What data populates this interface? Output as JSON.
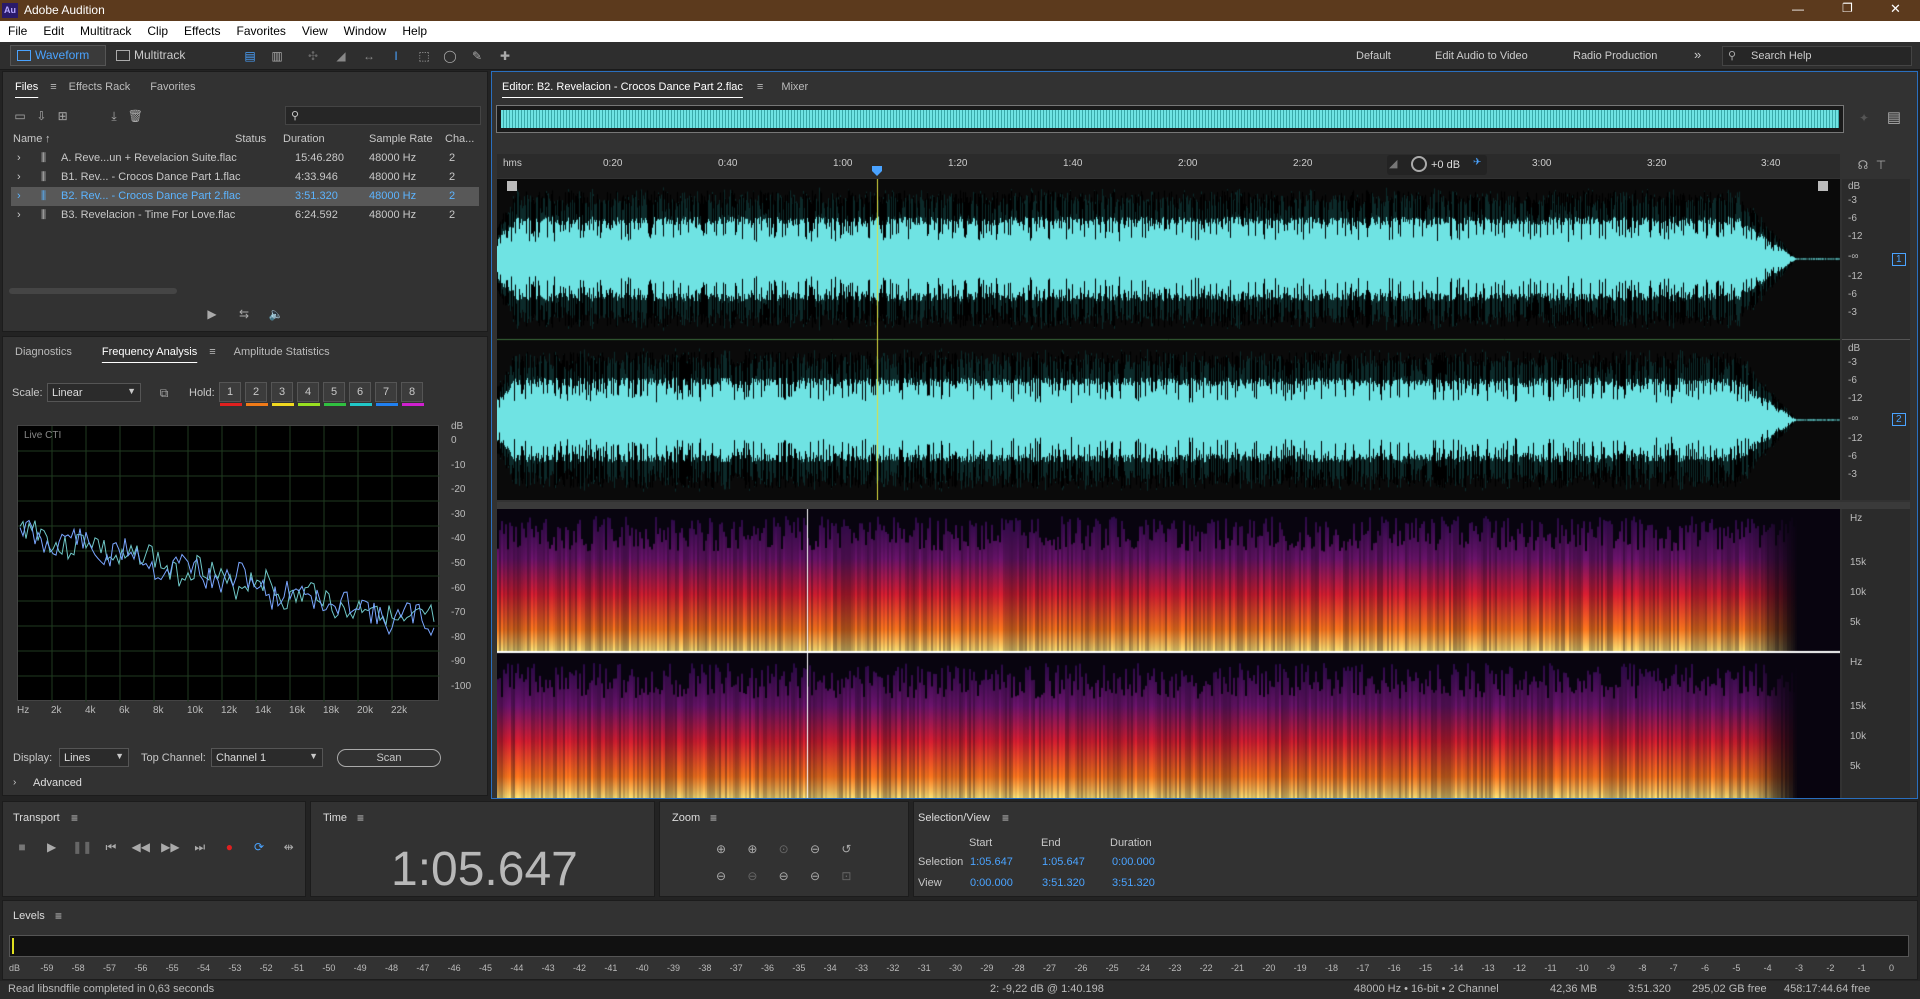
{
  "app": {
    "title": "Adobe Audition",
    "logo": "Au"
  },
  "menu": [
    "File",
    "Edit",
    "Multitrack",
    "Clip",
    "Effects",
    "Favorites",
    "View",
    "Window",
    "Help"
  ],
  "toolbar": {
    "waveform": "Waveform",
    "multitrack": "Multitrack",
    "workspaces": [
      "Default",
      "Edit Audio to Video",
      "Radio Production"
    ],
    "search_placeholder": "Search Help"
  },
  "files_panel": {
    "tabs": [
      "Files",
      "Effects Rack",
      "Favorites"
    ],
    "search_placeholder": "",
    "columns": [
      "Name",
      "Status",
      "Duration",
      "Sample Rate",
      "Cha..."
    ],
    "rows": [
      {
        "name": "A. Reve...un + Revelacion Suite.flac",
        "status": "",
        "duration": "15:46.280",
        "rate": "48000 Hz",
        "ch": "2"
      },
      {
        "name": "B1. Rev... - Crocos Dance Part 1.flac",
        "status": "",
        "duration": "4:33.946",
        "rate": "48000 Hz",
        "ch": "2"
      },
      {
        "name": "B2. Rev... - Crocos Dance Part 2.flac",
        "status": "",
        "duration": "3:51.320",
        "rate": "48000 Hz",
        "ch": "2"
      },
      {
        "name": "B3. Revelacion - Time For Love.flac",
        "status": "",
        "duration": "6:24.592",
        "rate": "48000 Hz",
        "ch": "2"
      }
    ],
    "selected_row": 2
  },
  "freq_panel": {
    "tabs": [
      "Diagnostics",
      "Frequency Analysis",
      "Amplitude Statistics"
    ],
    "scale_label": "Scale:",
    "scale_value": "Linear",
    "hold_label": "Hold:",
    "holds": [
      {
        "n": "1",
        "c": "#e0201f"
      },
      {
        "n": "2",
        "c": "#f07a18"
      },
      {
        "n": "3",
        "c": "#f0d820"
      },
      {
        "n": "4",
        "c": "#98e020"
      },
      {
        "n": "5",
        "c": "#30c040"
      },
      {
        "n": "6",
        "c": "#20c8c8"
      },
      {
        "n": "7",
        "c": "#2080f0"
      },
      {
        "n": "8",
        "c": "#d020d0"
      }
    ],
    "plot_label": "Live CTI",
    "db_unit": "dB",
    "db_ticks": [
      "0",
      "-10",
      "-20",
      "-30",
      "-40",
      "-50",
      "-60",
      "-70",
      "-80",
      "-90",
      "-100"
    ],
    "hz_ticks": [
      "Hz",
      "2k",
      "4k",
      "6k",
      "8k",
      "10k",
      "12k",
      "14k",
      "16k",
      "18k",
      "20k",
      "22k"
    ],
    "display_label": "Display:",
    "display_value": "Lines",
    "top_channel_label": "Top Channel:",
    "top_channel_value": "Channel 1",
    "scan": "Scan",
    "advanced": "Advanced"
  },
  "editor": {
    "tab": "Editor: B2. Revelacion - Crocos Dance Part 2.flac",
    "mixer": "Mixer",
    "ruler": [
      "hms",
      "0:20",
      "0:40",
      "1:00",
      "1:20",
      "1:40",
      "2:00",
      "2:20",
      "3:00",
      "3:20",
      "3:40"
    ],
    "gain": "+0 dB",
    "db_scale_1": [
      "dB",
      "-3",
      "-6",
      "-12",
      "-∞",
      "-12",
      "-6",
      "-3"
    ],
    "db_scale_2": [
      "dB",
      "-3",
      "-6",
      "-12",
      "-∞",
      "-12",
      "-6",
      "-3"
    ],
    "ch1": "1",
    "ch2": "2",
    "hz_scale": [
      "Hz",
      "15k",
      "10k",
      "5k"
    ],
    "waveform_color": "#6fe3e3"
  },
  "transport": {
    "title": "Transport"
  },
  "time": {
    "title": "Time",
    "value": "1:05.647"
  },
  "zoom": {
    "title": "Zoom"
  },
  "selview": {
    "title": "Selection/View",
    "cols": [
      "Start",
      "End",
      "Duration"
    ],
    "selection": {
      "label": "Selection",
      "start": "1:05.647",
      "end": "1:05.647",
      "dur": "0:00.000"
    },
    "view": {
      "label": "View",
      "start": "0:00.000",
      "end": "3:51.320",
      "dur": "3:51.320"
    }
  },
  "levels": {
    "title": "Levels",
    "ticks": [
      "dB",
      "-59",
      "-58",
      "-57",
      "-56",
      "-55",
      "-54",
      "-53",
      "-52",
      "-51",
      "-50",
      "-49",
      "-48",
      "-47",
      "-46",
      "-45",
      "-44",
      "-43",
      "-42",
      "-41",
      "-40",
      "-39",
      "-38",
      "-37",
      "-36",
      "-35",
      "-34",
      "-33",
      "-32",
      "-31",
      "-30",
      "-29",
      "-28",
      "-27",
      "-26",
      "-25",
      "-24",
      "-23",
      "-22",
      "-21",
      "-20",
      "-19",
      "-18",
      "-17",
      "-16",
      "-15",
      "-14",
      "-13",
      "-12",
      "-11",
      "-10",
      "-9",
      "-8",
      "-7",
      "-6",
      "-5",
      "-4",
      "-3",
      "-2",
      "-1",
      "0"
    ]
  },
  "status": {
    "left": "Read libsndfile completed in 0,63 seconds",
    "cursor": "2: -9,22 dB @ 1:40.198",
    "format": "48000 Hz • 16-bit • 2 Channel",
    "size": "42,36 MB",
    "duration": "3:51.320",
    "free": "295,02 GB free",
    "time_free": "458:17:44.64 free"
  }
}
